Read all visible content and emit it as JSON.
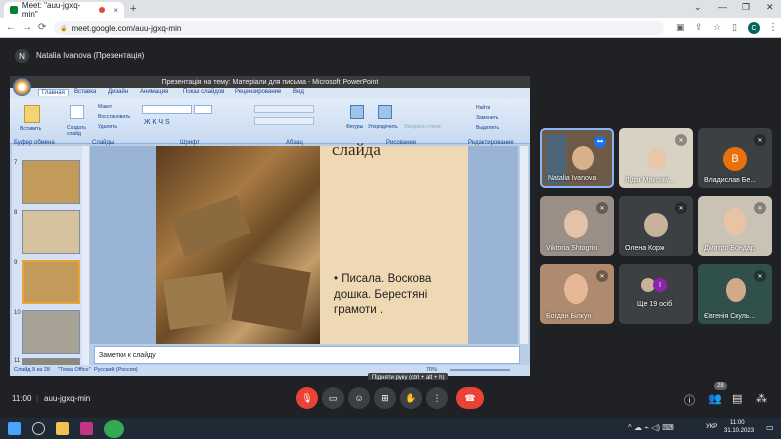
{
  "browser": {
    "tab_title": "Meet: \"auu-jgxq-min\"",
    "tab_close": "×",
    "new_tab": "+",
    "url": "meet.google.com/auu-jgxq-min",
    "profile_initial": "C",
    "win_min": "—",
    "win_restore": "❐",
    "win_close": "✕",
    "back": "←",
    "forward": "→",
    "reload": "⟳",
    "lock": "🔒"
  },
  "presentation": {
    "presenter_initial": "N",
    "label": "Natalia Ivanova (Презентація)"
  },
  "powerpoint": {
    "title": "Презентація на тему: Матеріали для письма - Microsoft PowerPoint",
    "tabs": [
      "Главная",
      "Вставка",
      "Дизайн",
      "Анимация",
      "Показ слайдов",
      "Рецензирование",
      "Вид"
    ],
    "groups": [
      "Буфер обмена",
      "Слайды",
      "Шрифт",
      "Абзац",
      "Рисование",
      "Редактирование"
    ],
    "buttons": {
      "paste": "Вставить",
      "create_slide": "Создать слайд",
      "layout": "Макет",
      "restore": "Восстановить",
      "delete": "Удалить",
      "shapes": "Фигуры",
      "arrange": "Упорядочить",
      "quick_styles": "Экспресс-стили",
      "find": "Найти",
      "replace": "Заменить",
      "select": "Выделить"
    },
    "thumb_numbers": [
      "7",
      "8",
      "9",
      "10",
      "11"
    ],
    "slide_title": "слайда",
    "slide_bullet": "Писала. Воскова дошка. Берестяні грамоти .",
    "notes_label": "Заметки к слайду",
    "status_left": "Слайд 9 из 28",
    "status_theme": "\"Тема Office\"",
    "status_lang": "Русский (Россия)",
    "zoom": "70%"
  },
  "participants": [
    {
      "name": "Natalia Ivanova",
      "type": "video",
      "color": "#6d5a48"
    },
    {
      "name": "Лідія Максим'...",
      "type": "video",
      "color": "#d8d2c5"
    },
    {
      "name": "Владислав Бе...",
      "type": "avatar",
      "initial": "B",
      "color": "#e8710a"
    },
    {
      "name": "Viktoria Shtogrin",
      "type": "video",
      "color": "#9a8f86"
    },
    {
      "name": "Олена Корж",
      "type": "avatar-photo",
      "color": "#3c4043"
    },
    {
      "name": "Дмитро Бондар",
      "type": "video",
      "color": "#c9c2b5"
    },
    {
      "name": "Богдан Білкун",
      "type": "video",
      "color": "#b08a6f"
    },
    {
      "name": "Ще 19 осіб",
      "type": "others",
      "initial": "I",
      "color": "#3c4043"
    },
    {
      "name": "Євгенія Скуль...",
      "type": "video",
      "color": "#2f5149"
    }
  ],
  "controls": {
    "time": "11:00",
    "meeting_code": "auu-jgxq-min",
    "tooltip": "Підняти руку (ctrl + alt + h)",
    "people_count": "28"
  },
  "taskbar": {
    "lang": "УКР",
    "time": "11:00",
    "date": "31.10.2023"
  }
}
